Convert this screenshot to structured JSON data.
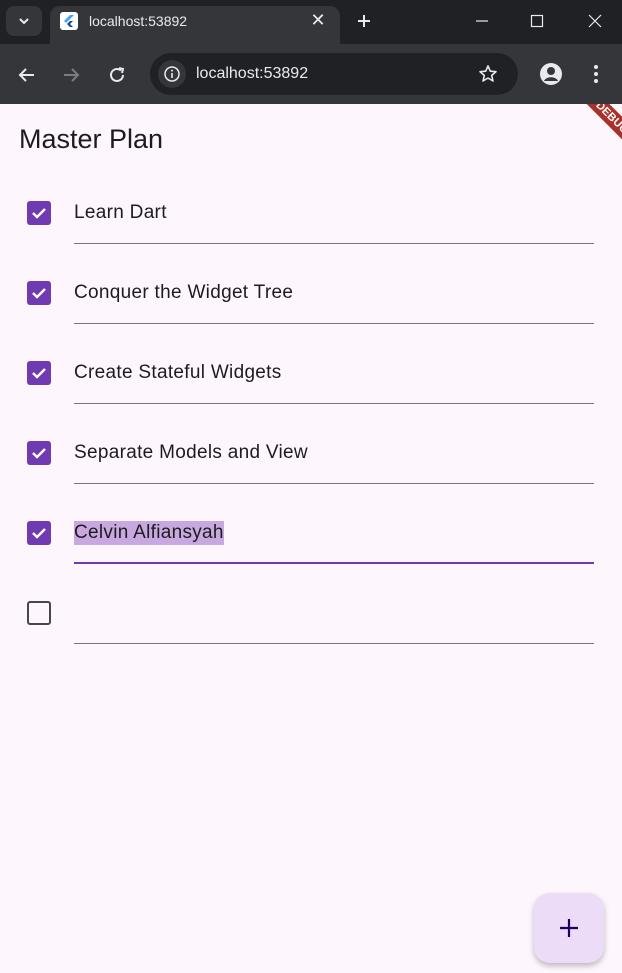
{
  "browser": {
    "tab_title": "localhost:53892",
    "url": "localhost:53892"
  },
  "app": {
    "title": "Master Plan",
    "debug_label": "DEBUG",
    "accent_color": "#6f3ab2",
    "tasks": [
      {
        "description": "Learn Dart",
        "complete": true
      },
      {
        "description": "Conquer the Widget Tree",
        "complete": true
      },
      {
        "description": "Create Stateful Widgets",
        "complete": true
      },
      {
        "description": "Separate Models and View",
        "complete": true
      },
      {
        "description": "Celvin Alfiansyah",
        "complete": true,
        "focused": true,
        "selected": true
      },
      {
        "description": "",
        "complete": false
      }
    ],
    "fab_icon": "plus-icon"
  }
}
